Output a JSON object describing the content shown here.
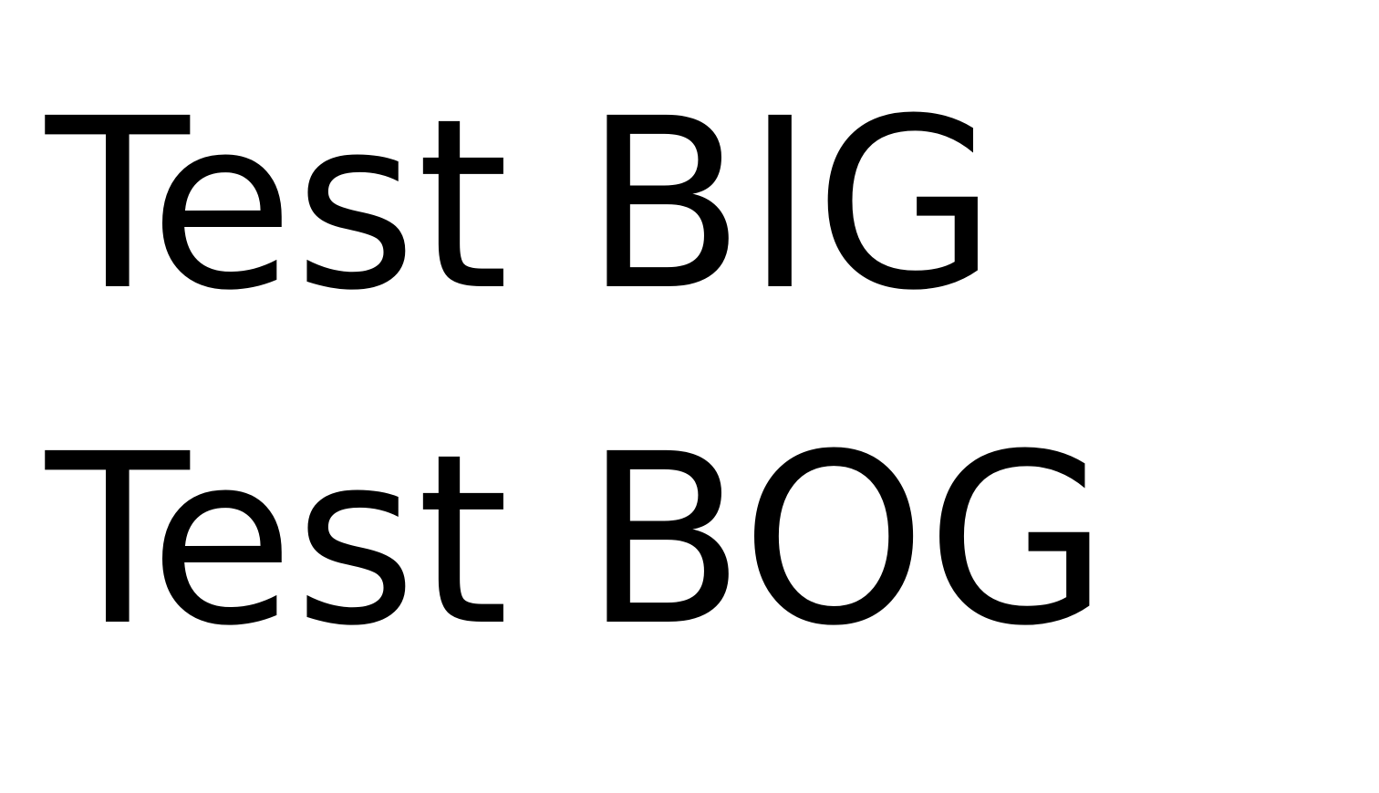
{
  "document": {
    "lines": [
      "Test BIG",
      "Test BOG"
    ]
  }
}
